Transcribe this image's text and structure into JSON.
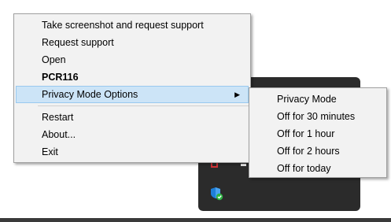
{
  "main_menu": {
    "items": [
      {
        "label": "Take screenshot and request support"
      },
      {
        "label": "Request support"
      },
      {
        "label": "Open"
      },
      {
        "label": "PCR116"
      },
      {
        "label": "Privacy Mode Options"
      },
      {
        "label": "Restart"
      },
      {
        "label": "About..."
      },
      {
        "label": "Exit"
      }
    ],
    "submenu_arrow": "▶"
  },
  "privacy_submenu": {
    "items": [
      {
        "label": "Privacy Mode"
      },
      {
        "label": "Off for 30 minutes"
      },
      {
        "label": "Off for 1 hour"
      },
      {
        "label": "Off for 2 hours"
      },
      {
        "label": "Off for today"
      }
    ]
  },
  "icons": {
    "tray_shield": "shield-check-icon",
    "submenu_arrow": "chevron-right-icon"
  },
  "colors": {
    "menu_bg": "#f2f2f2",
    "highlight_bg": "#cce4f7",
    "highlight_border": "#99c9ef",
    "tray_bg": "#2b2b2b",
    "shield_blue": "#1e7fd8",
    "check_green": "#2fb344"
  }
}
